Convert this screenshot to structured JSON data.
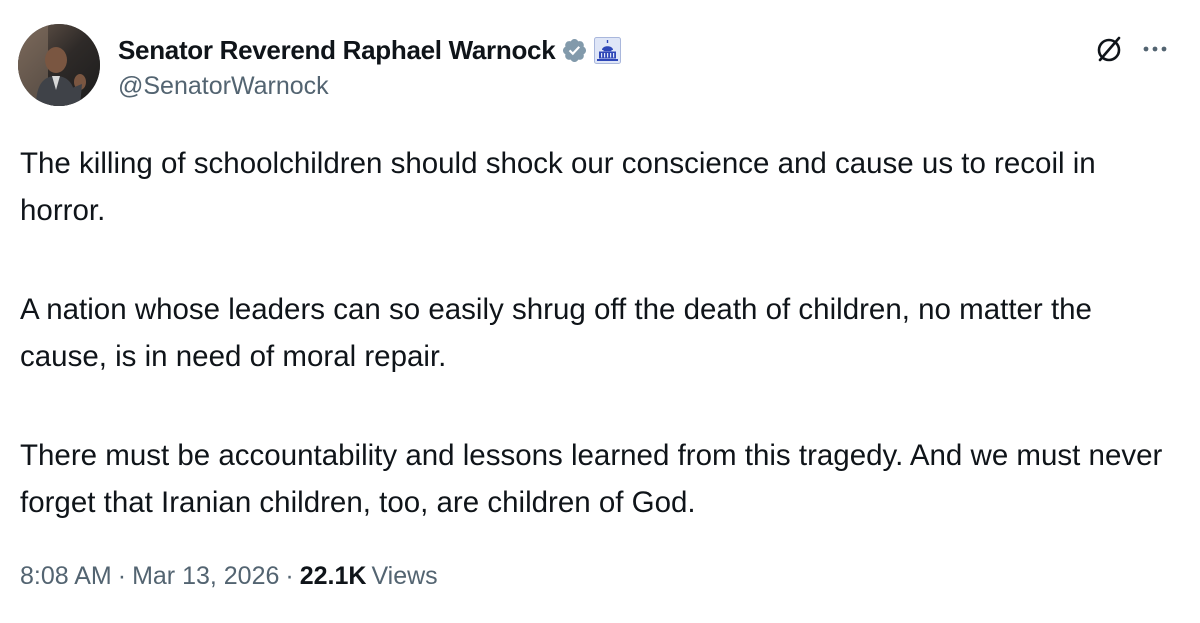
{
  "author": {
    "display_name": "Senator Reverend Raphael Warnock",
    "handle": "@SenatorWarnock",
    "verified_color": "#829aab",
    "affiliate_badge": "capitol-icon"
  },
  "tweet": {
    "paragraphs": [
      "The killing of schoolchildren should shock our conscience and cause us to recoil in horror.",
      "A nation whose leaders can so easily shrug off the death of children, no matter the cause, is in need of moral repair.",
      "There must be accountability and lessons learned from this tragedy. And we must never forget that Iranian children, too, are children of God."
    ]
  },
  "meta": {
    "time": "8:08 AM",
    "separator": "·",
    "date": "Mar 13, 2026",
    "views_count": "22.1K",
    "views_label": "Views"
  },
  "icons": {
    "grok": "grok-icon",
    "more": "more-icon"
  }
}
